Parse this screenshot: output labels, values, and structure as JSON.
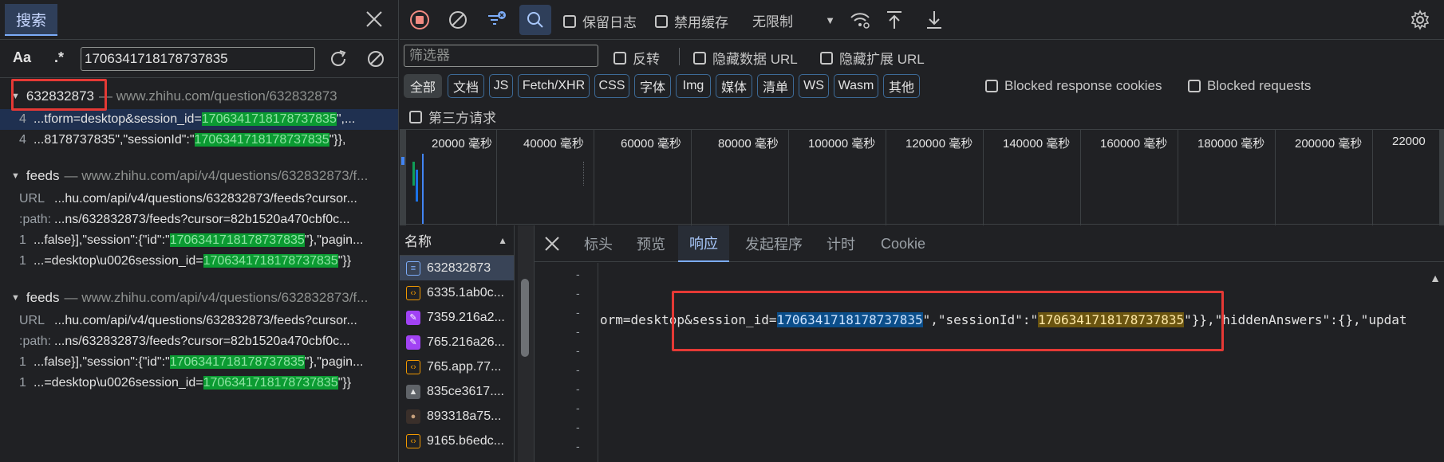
{
  "search": {
    "tab_label": "搜索",
    "match_case_label": "Aa",
    "regex_label": ".*",
    "query": "1706341718178737835",
    "groups": [
      {
        "name": "632832873",
        "url": "— www.zhihu.com/question/632832873",
        "rows": [
          {
            "line": "4",
            "pre": "...tform=desktop&session_id=",
            "hit": "1706341718178737835",
            "post": "\",..."
          },
          {
            "line": "4",
            "pre": "...8178737835\",\"sessionId\":\"",
            "hit": "1706341718178737835",
            "post": "\"}},"
          }
        ]
      },
      {
        "name": "feeds",
        "url": "— www.zhihu.com/api/v4/questions/632832873/f...",
        "rows": [
          {
            "line": "URL",
            "pre": "...hu.com/api/v4/questions/632832873/feeds?cursor...",
            "hit": "",
            "post": ""
          },
          {
            "line": ":path:",
            "pre": "...ns/632832873/feeds?cursor=82b1520a470cbf0c...",
            "hit": "",
            "post": ""
          },
          {
            "line": "1",
            "pre": "...false}],\"session\":{\"id\":\"",
            "hit": "1706341718178737835",
            "post": "\"},\"pagin..."
          },
          {
            "line": "1",
            "pre": "...=desktop\\u0026session_id=",
            "hit": "1706341718178737835",
            "post": "\"}}"
          }
        ]
      },
      {
        "name": "feeds",
        "url": "— www.zhihu.com/api/v4/questions/632832873/f...",
        "rows": [
          {
            "line": "URL",
            "pre": "...hu.com/api/v4/questions/632832873/feeds?cursor...",
            "hit": "",
            "post": ""
          },
          {
            "line": ":path:",
            "pre": "...ns/632832873/feeds?cursor=82b1520a470cbf0c...",
            "hit": "",
            "post": ""
          },
          {
            "line": "1",
            "pre": "...false}],\"session\":{\"id\":\"",
            "hit": "1706341718178737835",
            "post": "\"},\"pagin..."
          },
          {
            "line": "1",
            "pre": "...=desktop\\u0026session_id=",
            "hit": "1706341718178737835",
            "post": "\"}}"
          }
        ]
      }
    ]
  },
  "network": {
    "preserve_log": "保留日志",
    "disable_cache": "禁用缓存",
    "throttle": "无限制",
    "filter_placeholder": "筛选器",
    "invert": "反转",
    "hide_data_url": "隐藏数据 URL",
    "hide_ext_url": "隐藏扩展 URL",
    "types": [
      "全部",
      "文档",
      "JS",
      "Fetch/XHR",
      "CSS",
      "字体",
      "Img",
      "媒体",
      "清单",
      "WS",
      "Wasm",
      "其他"
    ],
    "blocked_cookies": "Blocked response cookies",
    "blocked_requests": "Blocked requests",
    "third_party": "第三方请求",
    "timeline_ticks": [
      "20000 毫秒",
      "40000 毫秒",
      "60000 毫秒",
      "80000 毫秒",
      "100000 毫秒",
      "120000 毫秒",
      "140000 毫秒",
      "160000 毫秒",
      "180000 毫秒",
      "200000 毫秒",
      "22000"
    ],
    "name_header": "名称",
    "requests": [
      {
        "name": "632832873",
        "kind": "doc"
      },
      {
        "name": "6335.1ab0c...",
        "kind": "js"
      },
      {
        "name": "7359.216a2...",
        "kind": "css"
      },
      {
        "name": "765.216a26...",
        "kind": "css"
      },
      {
        "name": "765.app.77...",
        "kind": "js"
      },
      {
        "name": "835ce3617....",
        "kind": "img"
      },
      {
        "name": "893318a75...",
        "kind": "img2"
      },
      {
        "name": "9165.b6edc...",
        "kind": "js"
      }
    ],
    "detail_tabs": [
      "标头",
      "预览",
      "响应",
      "发起程序",
      "计时",
      "Cookie"
    ],
    "response": {
      "pre": "orm=desktop&session_id=",
      "hit1": "1706341718178737835",
      "mid": "\",\"sessionId\":\"",
      "hit2": "1706341718178737835",
      "post": "\"}},\"hiddenAnswers\":{},\"updat"
    }
  }
}
